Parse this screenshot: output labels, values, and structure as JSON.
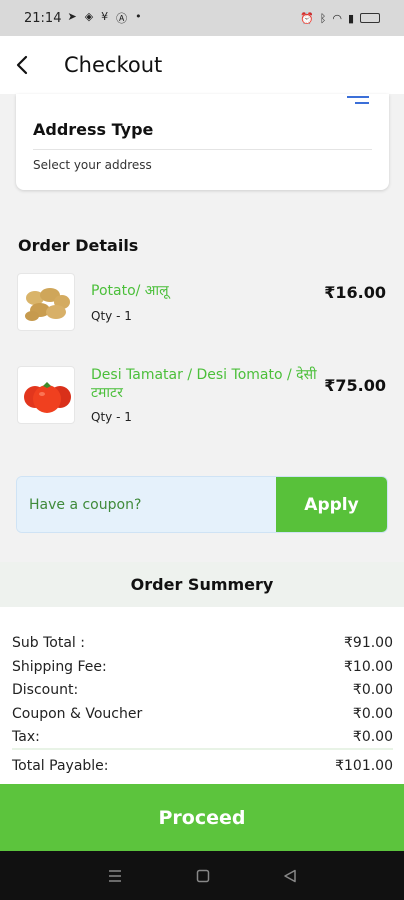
{
  "status_bar": {
    "time": "21:14"
  },
  "header": {
    "title": "Checkout"
  },
  "address": {
    "title": "Address Type",
    "subtitle": "Select your address"
  },
  "order": {
    "heading": "Order Details",
    "items": [
      {
        "name": "Potato/ आलू",
        "qty": "Qty - 1",
        "price": "₹16.00",
        "image": "potato-image"
      },
      {
        "name": "Desi Tamatar / Desi Tomato / देसी टमाटर",
        "qty": "Qty - 1",
        "price": "₹75.00",
        "image": "tomato-image"
      }
    ]
  },
  "coupon": {
    "placeholder": "Have a coupon?",
    "apply_label": "Apply"
  },
  "summary": {
    "heading": "Order Summery",
    "rows": [
      {
        "label": "Sub Total :",
        "value": "₹91.00"
      },
      {
        "label": "Shipping Fee:",
        "value": "₹10.00"
      },
      {
        "label": "Discount:",
        "value": "₹0.00"
      },
      {
        "label": "Coupon & Voucher",
        "value": "₹0.00"
      },
      {
        "label": "Tax:",
        "value": "₹0.00"
      }
    ],
    "total": {
      "label": "Total Payable:",
      "value": "₹101.00"
    }
  },
  "proceed_label": "Proceed",
  "colors": {
    "accent_green": "#5cc43d",
    "item_name_green": "#4bbf3a",
    "coupon_bg": "#e5f1fb"
  }
}
